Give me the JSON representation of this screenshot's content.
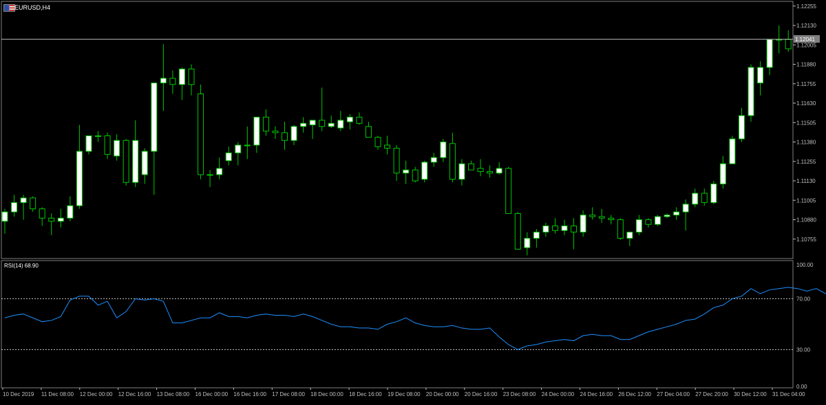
{
  "chart_data": [
    {
      "type": "candlestick",
      "title": "EURUSD,H4",
      "symbol": "EURUSD",
      "timeframe": "H4",
      "ylim": [
        1.1063,
        1.12285
      ],
      "y_ticks": [
        "1.12255",
        "1.12130",
        "1.12005",
        "1.11880",
        "1.11755",
        "1.11630",
        "1.11505",
        "1.11380",
        "1.11255",
        "1.11130",
        "1.11005",
        "1.10880",
        "1.10755"
      ],
      "current_price": "1.12041",
      "colors": {
        "background": "#000000",
        "bull_body": "#ffffff",
        "bear_body": "#000000",
        "wick": "#00c800",
        "price_line": "#c0c0c0",
        "axis": "#c0c0c0"
      },
      "ohlc": [
        [
          1.1087,
          1.1095,
          1.1079,
          1.1093
        ],
        [
          1.1093,
          1.1104,
          1.109,
          1.1099
        ],
        [
          1.1099,
          1.1104,
          1.1088,
          1.1102
        ],
        [
          1.1102,
          1.1103,
          1.1093,
          1.1095
        ],
        [
          1.1095,
          1.1096,
          1.1084,
          1.1089
        ],
        [
          1.1089,
          1.1092,
          1.1078,
          1.1087
        ],
        [
          1.1087,
          1.1095,
          1.1083,
          1.1089
        ],
        [
          1.1089,
          1.1103,
          1.1087,
          1.1097
        ],
        [
          1.1097,
          1.1149,
          1.1095,
          1.1132
        ],
        [
          1.1132,
          1.1142,
          1.113,
          1.1142
        ],
        [
          1.1142,
          1.1145,
          1.1138,
          1.1142
        ],
        [
          1.1142,
          1.1144,
          1.1127,
          1.113
        ],
        [
          1.1129,
          1.1143,
          1.1126,
          1.1139
        ],
        [
          1.1139,
          1.114,
          1.111,
          1.1112
        ],
        [
          1.1112,
          1.1152,
          1.1109,
          1.1139
        ],
        [
          1.1117,
          1.1134,
          1.1111,
          1.1132
        ],
        [
          1.1132,
          1.1168,
          1.1104,
          1.1176
        ],
        [
          1.1176,
          1.1201,
          1.1158,
          1.1179
        ],
        [
          1.1179,
          1.1184,
          1.1169,
          1.1175
        ],
        [
          1.1175,
          1.1186,
          1.1165,
          1.1185
        ],
        [
          1.1185,
          1.1188,
          1.1168,
          1.1175
        ],
        [
          1.1169,
          1.1175,
          1.1114,
          1.1117
        ],
        [
          1.1117,
          1.112,
          1.1109,
          1.1117
        ],
        [
          1.1117,
          1.1128,
          1.1114,
          1.1121
        ],
        [
          1.1126,
          1.1135,
          1.1123,
          1.1131
        ],
        [
          1.1131,
          1.1138,
          1.1123,
          1.1136
        ],
        [
          1.1136,
          1.1148,
          1.1127,
          1.1136
        ],
        [
          1.1136,
          1.1154,
          1.1131,
          1.1154
        ],
        [
          1.1154,
          1.1159,
          1.1142,
          1.1145
        ],
        [
          1.1145,
          1.1148,
          1.114,
          1.1144
        ],
        [
          1.1144,
          1.1151,
          1.1133,
          1.1139
        ],
        [
          1.1139,
          1.1149,
          1.1136,
          1.1148
        ],
        [
          1.1148,
          1.1154,
          1.1144,
          1.115
        ],
        [
          1.1149,
          1.1152,
          1.114,
          1.1152
        ],
        [
          1.1152,
          1.1173,
          1.1145,
          1.1148
        ],
        [
          1.1148,
          1.1155,
          1.1147,
          1.115
        ],
        [
          1.1147,
          1.1158,
          1.1145,
          1.1152
        ],
        [
          1.1151,
          1.1156,
          1.1146,
          1.1154
        ],
        [
          1.1154,
          1.1157,
          1.1149,
          1.115
        ],
        [
          1.1148,
          1.1151,
          1.1143,
          1.1141
        ],
        [
          1.1141,
          1.1142,
          1.1133,
          1.1135
        ],
        [
          1.1136,
          1.1142,
          1.113,
          1.1134
        ],
        [
          1.1134,
          1.1136,
          1.1113,
          1.1118
        ],
        [
          1.1118,
          1.1126,
          1.1111,
          1.112
        ],
        [
          1.112,
          1.1122,
          1.1112,
          1.1113
        ],
        [
          1.1114,
          1.1126,
          1.1112,
          1.1125
        ],
        [
          1.1125,
          1.1131,
          1.1122,
          1.1128
        ],
        [
          1.1128,
          1.114,
          1.1125,
          1.1138
        ],
        [
          1.1137,
          1.1144,
          1.1112,
          1.1114
        ],
        [
          1.1114,
          1.1127,
          1.111,
          1.1124
        ],
        [
          1.1124,
          1.1126,
          1.112,
          1.112
        ],
        [
          1.1121,
          1.1127,
          1.1116,
          1.1119
        ],
        [
          1.1119,
          1.1123,
          1.1115,
          1.1118
        ],
        [
          1.1118,
          1.1125,
          1.1117,
          1.1121
        ],
        [
          1.1121,
          1.1122,
          1.1092,
          1.1092
        ],
        [
          1.1092,
          1.1093,
          1.1069,
          1.1069
        ],
        [
          1.107,
          1.108,
          1.1065,
          1.1076
        ],
        [
          1.1076,
          1.1082,
          1.107,
          1.108
        ],
        [
          1.108,
          1.1086,
          1.1077,
          1.1084
        ],
        [
          1.1084,
          1.1089,
          1.1079,
          1.1081
        ],
        [
          1.1081,
          1.1088,
          1.1078,
          1.1084
        ],
        [
          1.1084,
          1.1089,
          1.1069,
          1.108
        ],
        [
          1.108,
          1.1094,
          1.1077,
          1.1091
        ],
        [
          1.1091,
          1.1096,
          1.1088,
          1.109
        ],
        [
          1.109,
          1.1095,
          1.1086,
          1.1089
        ],
        [
          1.1089,
          1.1091,
          1.1085,
          1.1088
        ],
        [
          1.1088,
          1.1089,
          1.1075,
          1.1076
        ],
        [
          1.1076,
          1.108,
          1.1071,
          1.108
        ],
        [
          1.108,
          1.1091,
          1.1078,
          1.1088
        ],
        [
          1.1088,
          1.1089,
          1.1083,
          1.1085
        ],
        [
          1.1085,
          1.1091,
          1.1084,
          1.109
        ],
        [
          1.109,
          1.1092,
          1.1089,
          1.1091
        ],
        [
          1.1091,
          1.1096,
          1.1088,
          1.1093
        ],
        [
          1.1093,
          1.1101,
          1.1081,
          1.1098
        ],
        [
          1.1098,
          1.1108,
          1.1096,
          1.1105
        ],
        [
          1.1105,
          1.1108,
          1.1097,
          1.1099
        ],
        [
          1.1099,
          1.1113,
          1.1098,
          1.1111
        ],
        [
          1.1111,
          1.1129,
          1.1108,
          1.1124
        ],
        [
          1.1124,
          1.1142,
          1.1124,
          1.114
        ],
        [
          1.114,
          1.116,
          1.1138,
          1.1155
        ],
        [
          1.1155,
          1.1188,
          1.1151,
          1.1186
        ],
        [
          1.1176,
          1.119,
          1.1168,
          1.1186
        ],
        [
          1.1186,
          1.1204,
          1.1181,
          1.1204
        ],
        [
          1.1204,
          1.1213,
          1.1195,
          1.1204
        ],
        [
          1.1204,
          1.121,
          1.1196,
          1.1198
        ],
        [
          1.1198,
          1.1205,
          1.1187,
          1.12
        ],
        [
          1.12,
          1.1214,
          1.1194,
          1.1212
        ],
        [
          1.1212,
          1.1221,
          1.1201,
          1.12
        ],
        [
          1.12,
          1.1213,
          1.1202,
          1.1212
        ],
        [
          1.1212,
          1.1214,
          1.1203,
          1.1205
        ]
      ],
      "x_tick_labels": [
        "10 Dec 2019",
        "11 Dec 08:00",
        "12 Dec 00:00",
        "12 Dec 16:00",
        "13 Dec 08:00",
        "16 Dec 00:00",
        "16 Dec 16:00",
        "17 Dec 08:00",
        "18 Dec 00:00",
        "18 Dec 16:00",
        "19 Dec 08:00",
        "20 Dec 00:00",
        "20 Dec 16:00",
        "23 Dec 08:00",
        "24 Dec 00:00",
        "24 Dec 16:00",
        "26 Dec 12:00",
        "27 Dec 04:00",
        "27 Dec 20:00",
        "30 Dec 12:00",
        "31 Dec 04:00"
      ]
    },
    {
      "type": "line",
      "title": "RSI(14) 68.90",
      "ylim": [
        0,
        100
      ],
      "y_ticks": [
        "100.00",
        "70.00",
        "30.00",
        "0.00"
      ],
      "levels": [
        70,
        30
      ],
      "colors": {
        "line": "#1e90ff",
        "level": "#c0c0c0"
      },
      "values": [
        55,
        57,
        58,
        55,
        52,
        53,
        56,
        69,
        72,
        72,
        65,
        68,
        55,
        60,
        70,
        69,
        70,
        68,
        51,
        51,
        53,
        55,
        55,
        59,
        56,
        56,
        55,
        57,
        58,
        57,
        57,
        56,
        58,
        56,
        53,
        50,
        48,
        48,
        47,
        47,
        46,
        50,
        52,
        55,
        51,
        49,
        48,
        48,
        49,
        47,
        46,
        46,
        47,
        40,
        34,
        30,
        33,
        34,
        36,
        37,
        38,
        37,
        41,
        42,
        41,
        41,
        38,
        38,
        41,
        44,
        46,
        48,
        50,
        53,
        54,
        58,
        63,
        65,
        70,
        72,
        78,
        74,
        77,
        78,
        79,
        78,
        76,
        78,
        74,
        71,
        72,
        69
      ],
      "current": "68.90"
    }
  ]
}
